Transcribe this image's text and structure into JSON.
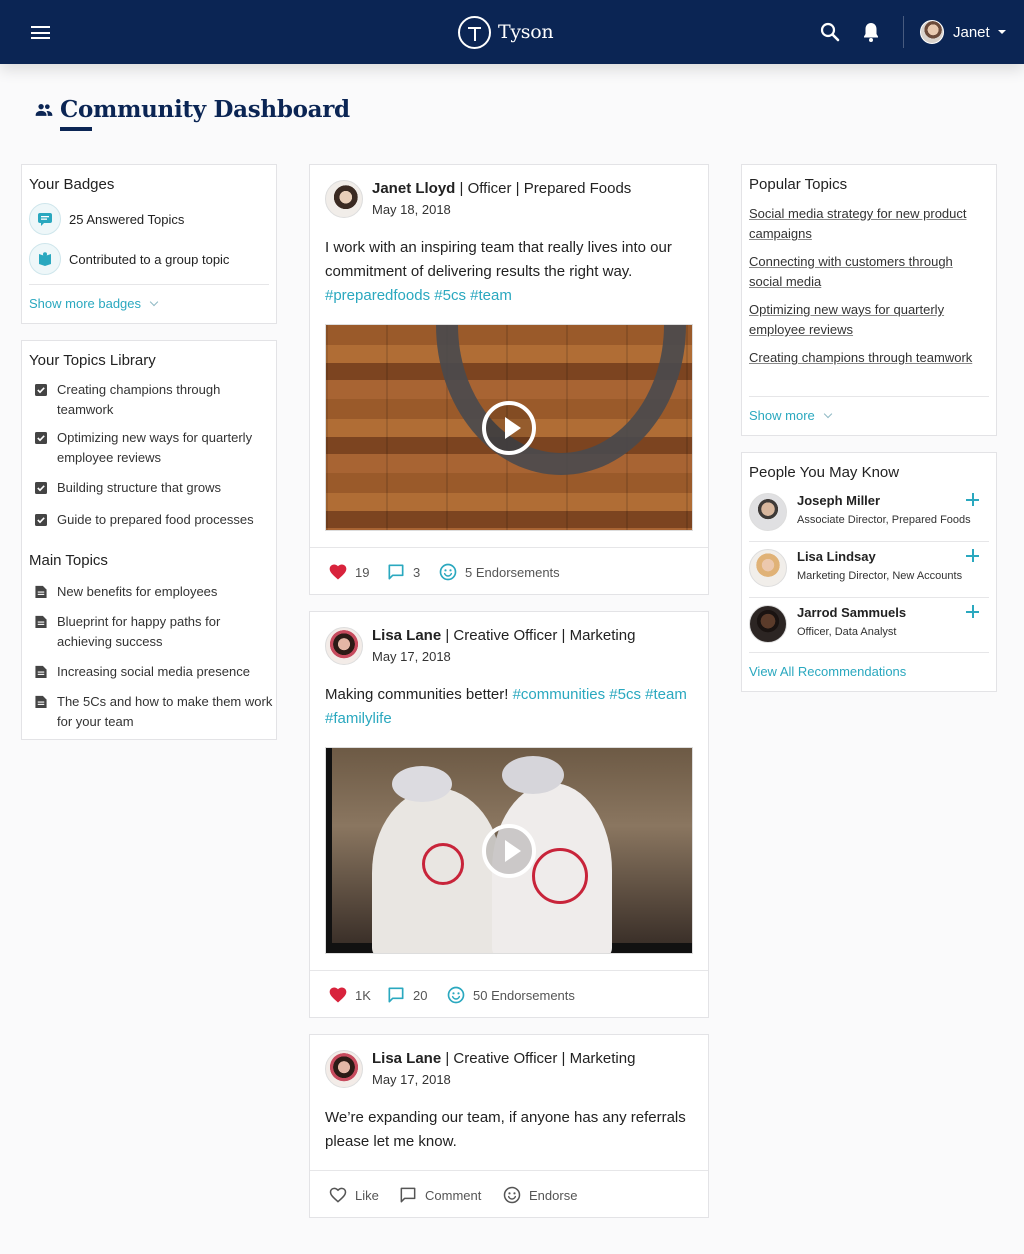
{
  "header": {
    "brand": "Tyson",
    "user_name": "Janet"
  },
  "page": {
    "title": "Community Dashboard"
  },
  "badges": {
    "title": "Your Badges",
    "items": [
      {
        "label": "25 Answered Topics",
        "icon": "chat-badge-icon"
      },
      {
        "label": "Contributed to a group topic",
        "icon": "book-badge-icon"
      }
    ],
    "show_more": "Show more badges"
  },
  "topics_library": {
    "title": "Your Topics Library",
    "items": [
      {
        "label": "Creating champions through teamwork"
      },
      {
        "label": "Optimizing new ways for quarterly employee reviews"
      },
      {
        "label": "Building structure that grows"
      },
      {
        "label": "Guide to prepared food processes"
      }
    ]
  },
  "main_topics": {
    "title": "Main Topics",
    "items": [
      {
        "label": "New benefits for employees"
      },
      {
        "label": "Blueprint for happy paths for achieving success"
      },
      {
        "label": "Increasing social media presence"
      },
      {
        "label": "The 5Cs and how to make them work for your team"
      }
    ]
  },
  "posts": [
    {
      "name": "Janet Lloyd",
      "title": " | Officer | Prepared Foods",
      "date": "May 18, 2018",
      "text": "I work with an inspiring team that really lives into our commitment of delivering results the right way. ",
      "tags": [
        "#preparedfoods",
        "#5cs",
        "#team"
      ],
      "likes": "19",
      "comments": "3",
      "endorsements": "5 Endorsements"
    },
    {
      "name": "Lisa Lane",
      "title": " | Creative Officer | Marketing",
      "date": "May 17, 2018",
      "text": "Making communities better! ",
      "tags": [
        "#communities",
        "#5cs",
        "#team",
        "#familylife"
      ],
      "likes": "1K",
      "comments": "20",
      "endorsements": "50 Endorsements"
    },
    {
      "name": "Lisa Lane",
      "title": " | Creative Officer | Marketing",
      "date": "May 17, 2018",
      "text": "We’re expanding our team, if anyone has any referrals please let me know.",
      "like_label": "Like",
      "comment_label": "Comment",
      "endorse_label": "Endorse"
    }
  ],
  "popular_topics": {
    "title": "Popular Topics",
    "items": [
      {
        "label": "Social media strategy for new product campaigns"
      },
      {
        "label": "Connecting with customers through social media"
      },
      {
        "label": "Optimizing new ways for quarterly employee reviews"
      },
      {
        "label": "Creating champions through teamwork"
      }
    ],
    "show_more": "Show more"
  },
  "people": {
    "title": "People You May Know",
    "items": [
      {
        "name": "Joseph Miller",
        "role": "Associate Director, Prepared Foods"
      },
      {
        "name": "Lisa Lindsay",
        "role": "Marketing Director, New Accounts"
      },
      {
        "name": "Jarrod Sammuels",
        "role": "Officer, Data Analyst"
      }
    ],
    "view_all": "View All Recommendations"
  },
  "colors": {
    "navy": "#0b2554",
    "accent": "#2aa8bf",
    "heart": "#d8233c"
  }
}
